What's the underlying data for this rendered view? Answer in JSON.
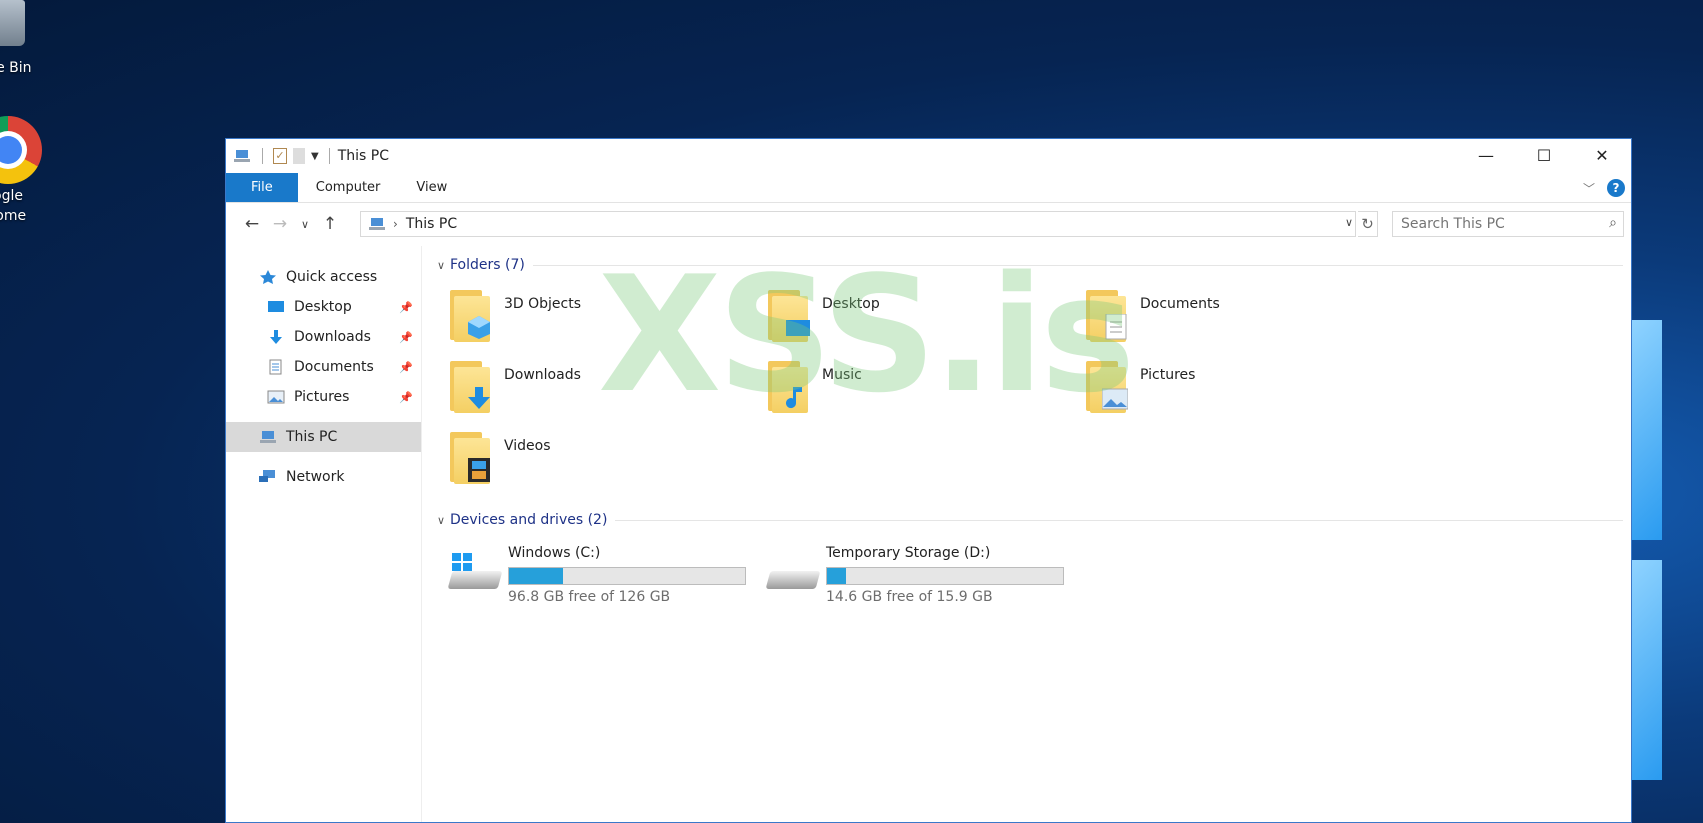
{
  "desktop": {
    "icons": [
      {
        "label": "cle Bin"
      },
      {
        "label": "ogle\nrome"
      }
    ]
  },
  "window": {
    "title": "This PC",
    "controls": {
      "minimize": "—",
      "maximize": "☐",
      "close": "✕"
    }
  },
  "ribbon": {
    "tabs": [
      "File",
      "Computer",
      "View"
    ]
  },
  "address": {
    "path": "This PC",
    "search_placeholder": "Search This PC"
  },
  "navpane": {
    "quick_access": "Quick access",
    "pinned": [
      "Desktop",
      "Downloads",
      "Documents",
      "Pictures"
    ],
    "this_pc": "This PC",
    "network": "Network"
  },
  "content": {
    "folders_header": "Folders (7)",
    "folders": [
      "3D Objects",
      "Desktop",
      "Documents",
      "Downloads",
      "Music",
      "Pictures",
      "Videos"
    ],
    "drives_header": "Devices and drives (2)",
    "drives": [
      {
        "name": "Windows (C:)",
        "free": "96.8 GB free of 126 GB",
        "used_fraction": 0.23
      },
      {
        "name": "Temporary Storage (D:)",
        "free": "14.6 GB free of 15.9 GB",
        "used_fraction": 0.08
      }
    ]
  },
  "watermark": "XSS.is",
  "colors": {
    "accent": "#1979ca",
    "bar_fill": "#26a0da"
  }
}
